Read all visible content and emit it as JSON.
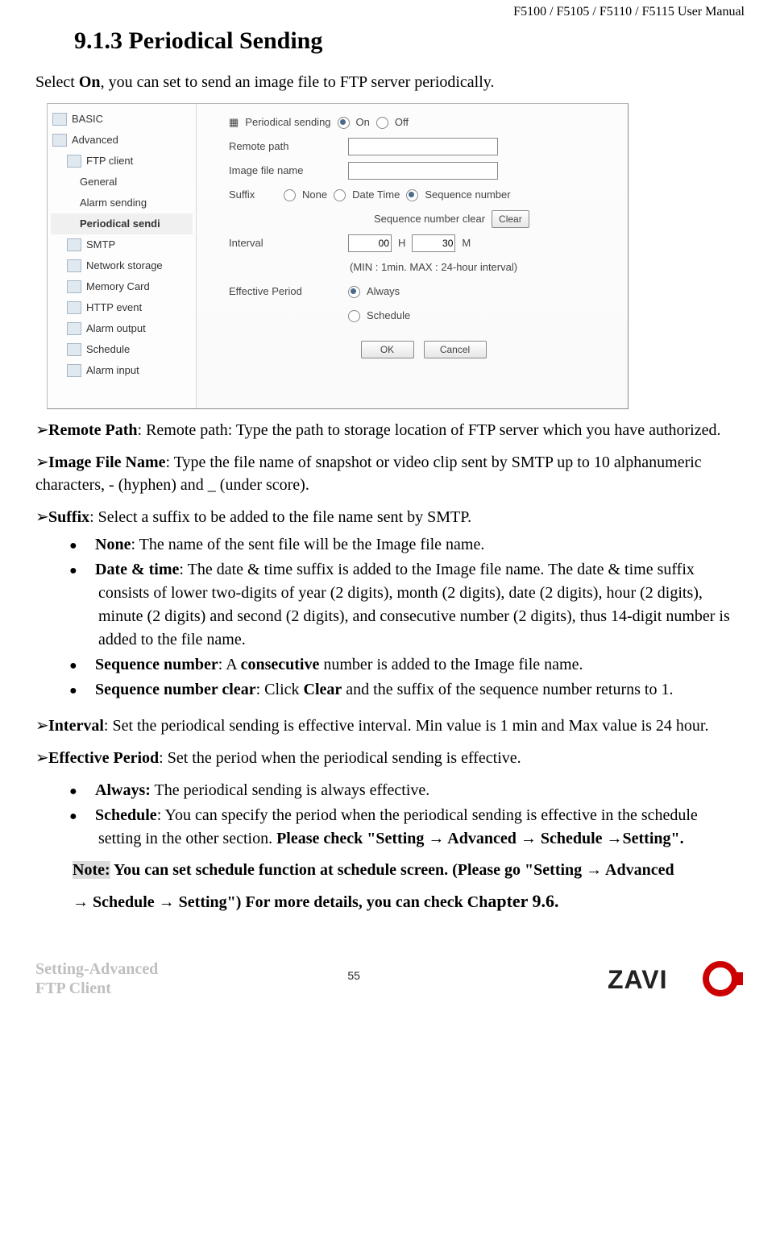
{
  "header": {
    "right": "F5100 / F5105 / F5110 / F5115 User Manual"
  },
  "title": "9.1.3 Periodical Sending",
  "intro": {
    "pre": "Select ",
    "on": "On",
    "post": ", you can set to send an image file to FTP server periodically."
  },
  "shot": {
    "nav": {
      "basic": "BASIC",
      "advanced": "Advanced",
      "ftp": "FTP client",
      "general": "General",
      "alarm": "Alarm sending",
      "periodical": "Periodical sendi",
      "smtp": "SMTP",
      "netstorage": "Network storage",
      "memcard": "Memory Card",
      "http": "HTTP event",
      "alarmout": "Alarm output",
      "schedule": "Schedule",
      "alarmin": "Alarm input"
    },
    "main": {
      "periodical_sending_label": "Periodical sending",
      "on": "On",
      "off": "Off",
      "remote_path": "Remote path",
      "image_file_name": "Image file name",
      "suffix": "Suffix",
      "none": "None",
      "date_time": "Date Time",
      "seq_num": "Sequence number",
      "seq_clear_label": "Sequence number clear",
      "clear_btn": "Clear",
      "interval": "Interval",
      "interval_h_value": "00",
      "interval_h": "H",
      "interval_m_value": "30",
      "interval_m": "M",
      "interval_note": "(MIN : 1min. MAX : 24-hour interval)",
      "effective_period": "Effective Period",
      "always": "Always",
      "schedule": "Schedule",
      "ok": "OK",
      "cancel": "Cancel"
    }
  },
  "items": {
    "remote_path": {
      "label": "Remote Path",
      "text": ": Remote path: Type the path to storage location of FTP server which you have authorized."
    },
    "image_file_name": {
      "label": "Image File Name",
      "text": ": Type the file name of snapshot or video clip sent by SMTP up to 10 alphanumeric characters, - (hyphen) and _ (under score)."
    },
    "suffix": {
      "label": "Suffix",
      "text": ": Select a suffix to be added to the file name sent by SMTP."
    },
    "suffix_sub": {
      "none": {
        "label": "None",
        "text": ": The name of the sent file will be the Image file name."
      },
      "date_time": {
        "label": "Date & time",
        "text": ": The date & time suffix is added to the Image file name. The date & time suffix consists of lower two-digits of year (2 digits), month (2 digits), date (2 digits), hour (2 digits), minute (2 digits) and second (2 digits), and consecutive number (2 digits), thus 14-digit number is added to the file name."
      },
      "seq_num": {
        "label": "Sequence number",
        "text_pre": ": A ",
        "text_mid": "consecutive",
        "text_post": " number is added to the Image file name."
      },
      "seq_clear": {
        "label": "Sequence number clear",
        "text_pre": ": Click ",
        "text_mid": "Clear",
        "text_post": " and the suffix of the sequence number returns to 1."
      }
    },
    "interval": {
      "label": "Interval",
      "text": ": Set the periodical sending is effective interval. Min value is 1 min and Max value is 24 hour."
    },
    "effective": {
      "label": "Effective Period",
      "text": ": Set the period when the periodical sending is effective."
    },
    "effective_sub": {
      "always": {
        "label": "Always:",
        "text": " The periodical sending is always effective."
      },
      "schedule": {
        "label": "Schedule",
        "text_pre": ": You can specify the period when the periodical sending is effective in the schedule setting in the other section. ",
        "text_bold": "Please check \"Setting → Advanced → Schedule →Setting\"."
      }
    },
    "note": {
      "label": "Note:",
      "line1": " You can set schedule function at schedule screen. (Please go \"Setting → Advanced",
      "line2_pre": "→ Schedule → Setting\") For more details, you can check Ch",
      "line2_big": "apter 9.6."
    }
  },
  "footer": {
    "left1": "Setting-Advanced",
    "left2": "FTP Client",
    "page": "55",
    "logo_text": "ZAVI"
  }
}
